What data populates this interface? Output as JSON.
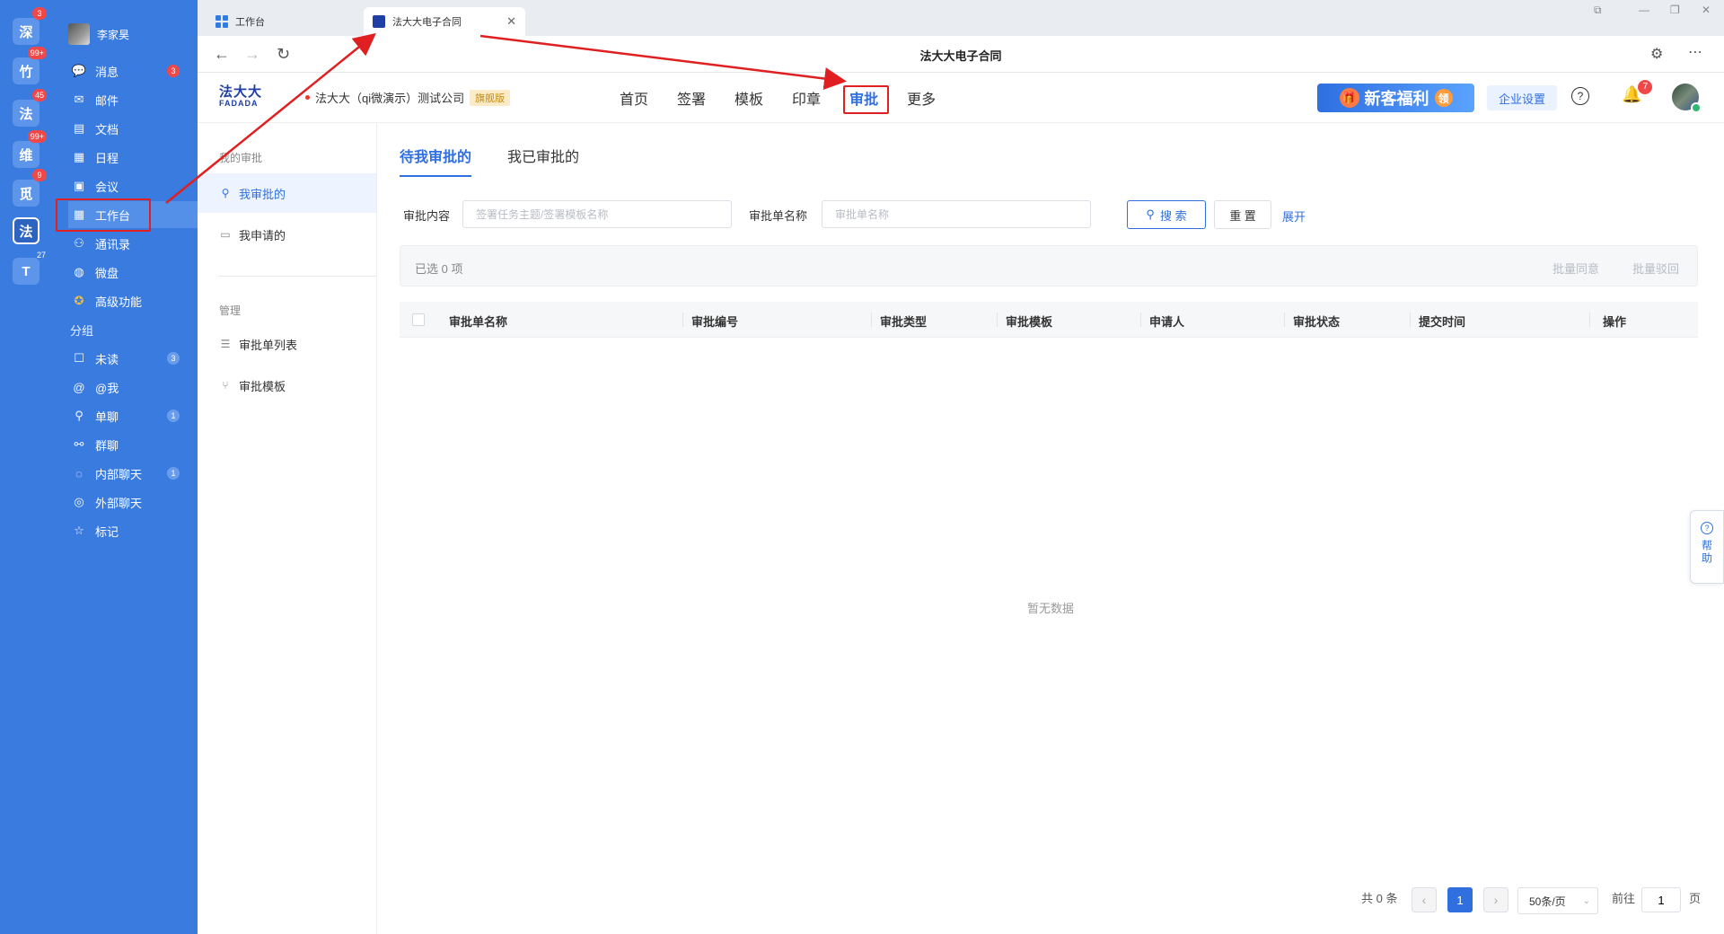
{
  "rail": [
    {
      "char": "深",
      "badge": "3"
    },
    {
      "char": "竹",
      "badge": "99+"
    },
    {
      "char": "法",
      "badge": "45"
    },
    {
      "char": "维",
      "badge": "99+"
    },
    {
      "char": "觅",
      "badge": "9"
    },
    {
      "char": "法",
      "badge": ""
    },
    {
      "char": "T",
      "badge": "27"
    }
  ],
  "messenger": {
    "user_name": "李家昊",
    "items": [
      {
        "label": "消息",
        "icon": "chat-icon",
        "count": "3"
      },
      {
        "label": "邮件",
        "icon": "mail-icon",
        "count": ""
      },
      {
        "label": "文档",
        "icon": "doc-icon",
        "count": ""
      },
      {
        "label": "日程",
        "icon": "calendar-icon",
        "count": ""
      },
      {
        "label": "会议",
        "icon": "meeting-icon",
        "count": ""
      },
      {
        "label": "工作台",
        "icon": "grid-icon",
        "count": ""
      },
      {
        "label": "通讯录",
        "icon": "contacts-icon",
        "count": ""
      },
      {
        "label": "微盘",
        "icon": "drive-icon",
        "count": ""
      },
      {
        "label": "高级功能",
        "icon": "star-badge-icon",
        "count": ""
      }
    ],
    "group_title": "分组",
    "group_items": [
      {
        "label": "未读",
        "icon": "unread-icon",
        "count": "3"
      },
      {
        "label": "@我",
        "icon": "at-icon",
        "count": ""
      },
      {
        "label": "单聊",
        "icon": "person-icon",
        "count": "1"
      },
      {
        "label": "群聊",
        "icon": "group-icon",
        "count": ""
      },
      {
        "label": "内部聊天",
        "icon": "bubble-icon",
        "count": "1"
      },
      {
        "label": "外部聊天",
        "icon": "bubbles-icon",
        "count": ""
      },
      {
        "label": "标记",
        "icon": "star-icon",
        "count": ""
      }
    ]
  },
  "browser": {
    "tabs": [
      {
        "label": "工作台"
      },
      {
        "label": "法大大电子合同"
      }
    ],
    "page_title": "法大大电子合同"
  },
  "header": {
    "logo_line1": "法大大",
    "logo_line2": "FADADA",
    "org_name": "法大大（qi微演示）测试公司",
    "edition": "旗舰版",
    "nav": [
      "首页",
      "签署",
      "模板",
      "印章",
      "审批",
      "更多"
    ],
    "active_nav": "审批",
    "promo_text": "新客福利",
    "promo_badge": "领",
    "enterprise_settings": "企业设置",
    "notification_count": "7"
  },
  "subnav": {
    "section1_title": "我的审批",
    "section1_items": [
      "我审批的",
      "我申请的"
    ],
    "section2_title": "管理",
    "section2_items": [
      "审批单列表",
      "审批模板"
    ]
  },
  "main": {
    "tabs": [
      "待我审批的",
      "我已审批的"
    ],
    "filters": {
      "content_label": "审批内容",
      "content_placeholder": "签署任务主题/签署模板名称",
      "name_label": "审批单名称",
      "name_placeholder": "审批单名称",
      "search_label": "搜 索",
      "reset_label": "重 置",
      "expand_label": "展开"
    },
    "selection_text": "已选 0 项",
    "batch_approve": "批量同意",
    "batch_reject": "批量驳回",
    "columns": [
      "审批单名称",
      "审批编号",
      "审批类型",
      "审批模板",
      "申请人",
      "审批状态",
      "提交时间",
      "操作"
    ],
    "empty_text": "暂无数据",
    "pagination": {
      "total": "共 0 条",
      "current_page": "1",
      "page_size": "50条/页",
      "goto_prefix": "前往",
      "goto_value": "1",
      "goto_suffix": "页"
    }
  },
  "help_float": "帮助"
}
